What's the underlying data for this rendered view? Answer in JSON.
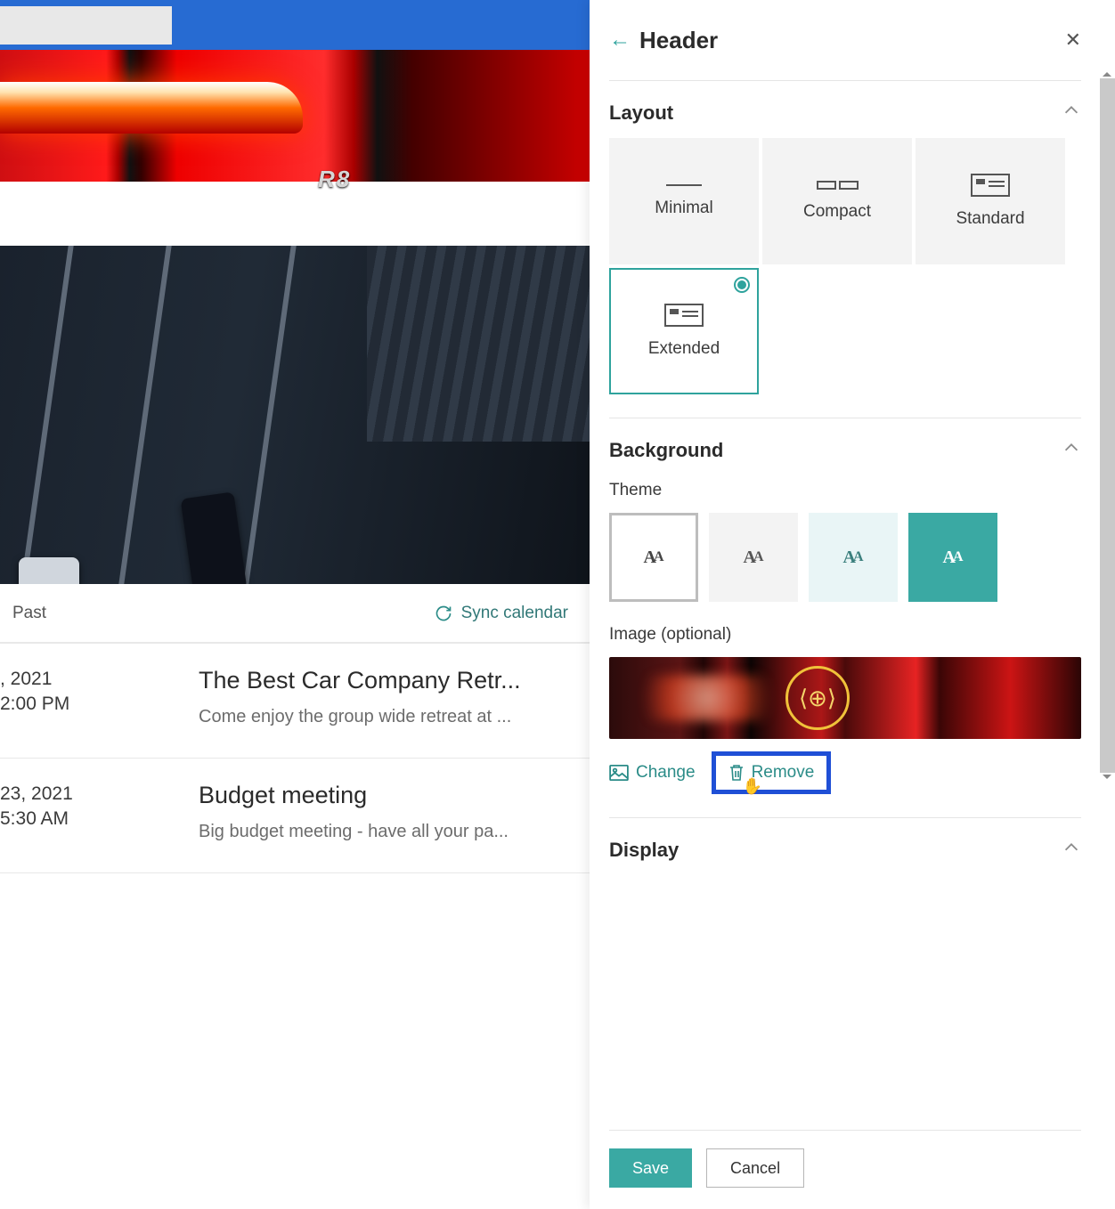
{
  "banner": {
    "badge": "R8"
  },
  "toolbar": {
    "past": "Past",
    "sync": "Sync calendar"
  },
  "events": [
    {
      "date": ", 2021",
      "time": " 2:00 PM",
      "title": "The Best Car Company Retr...",
      "desc": "Come enjoy the group wide retreat at ..."
    },
    {
      "date": " 23, 2021",
      "time": " 5:30 AM",
      "title": "Budget meeting",
      "desc": "Big budget meeting - have all your pa..."
    }
  ],
  "panel": {
    "title": "Header",
    "layout": {
      "title": "Layout",
      "options": {
        "minimal": "Minimal",
        "compact": "Compact",
        "standard": "Standard",
        "extended": "Extended"
      },
      "selected": "extended"
    },
    "background": {
      "title": "Background",
      "theme_label": "Theme",
      "image_label": "Image (optional)",
      "change": "Change",
      "remove": "Remove"
    },
    "display": {
      "title": "Display"
    },
    "save": "Save",
    "cancel": "Cancel"
  }
}
